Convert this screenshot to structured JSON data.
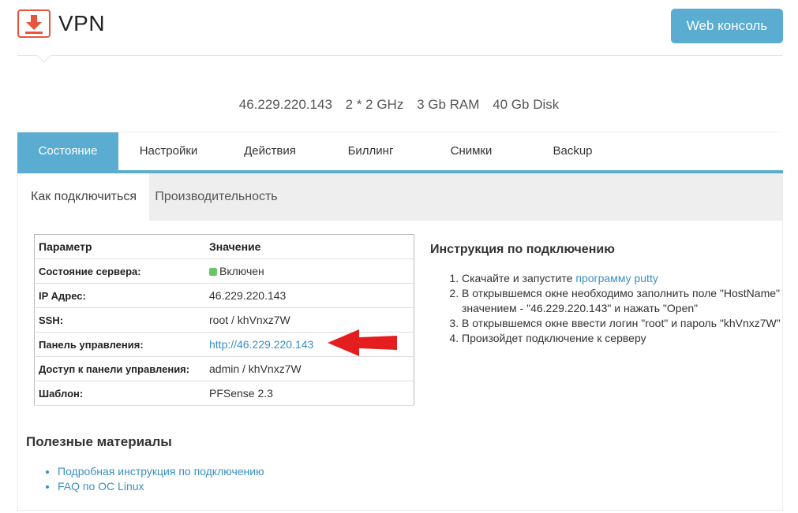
{
  "app": {
    "title": "VPN",
    "web_console_label": "Web консоль"
  },
  "colors": {
    "accent": "#5aacd0",
    "logo": "#e8553a",
    "link": "#3a8fc1",
    "status_on": "#6bc46b",
    "arrow": "#e41e1e"
  },
  "server_specs": {
    "ip": "46.229.220.143",
    "cpu": "2 * 2 GHz",
    "ram": "3 Gb RAM",
    "disk": "40 Gb Disk"
  },
  "tabs": [
    {
      "label": "Состояние",
      "active": true
    },
    {
      "label": "Настройки"
    },
    {
      "label": "Действия"
    },
    {
      "label": "Биллинг"
    },
    {
      "label": "Снимки"
    },
    {
      "label": "Backup"
    }
  ],
  "subtabs": [
    {
      "label": "Как подключиться",
      "active": true
    },
    {
      "label": "Производительность"
    }
  ],
  "params_table": {
    "headers": [
      "Параметр",
      "Значение"
    ],
    "rows": [
      {
        "key": "Состояние сервера:",
        "value": "Включен"
      },
      {
        "key": "IP Адрес:",
        "value": "46.229.220.143"
      },
      {
        "key": "SSH:",
        "value": "root / khVnxz7W"
      },
      {
        "key": "Панель управления:",
        "value": "http://46.229.220.143"
      },
      {
        "key": "Доступ к панели управления:",
        "value": "admin / khVnxz7W"
      },
      {
        "key": "Шаблон:",
        "value": "PFSense 2.3"
      }
    ]
  },
  "instructions": {
    "title": "Инструкция по подключению",
    "step1_text": "Скачайте и запустите ",
    "step1_link": "программу putty",
    "step2": "В открывшемся окне необходимо заполнить поле \"HostName\" значением - \"46.229.220.143\" и нажать \"Open\"",
    "step3": "В открывшемся окне ввести логин \"root\" и пароль \"khVnxz7W\"",
    "step4": "Произойдет подключение к серверу"
  },
  "useful": {
    "title": "Полезные материалы",
    "links": [
      "Подробная инструкция по подключению",
      "FAQ по ОС Linux"
    ]
  }
}
